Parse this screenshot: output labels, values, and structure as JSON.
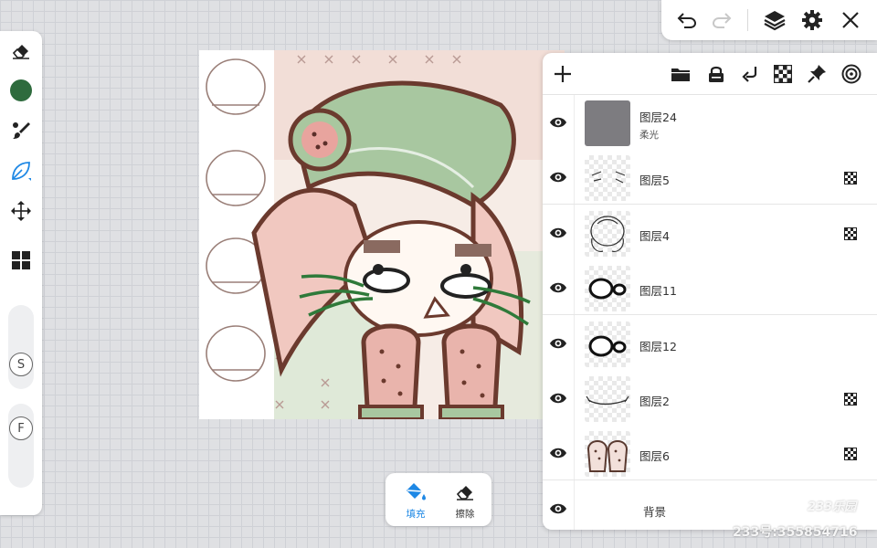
{
  "left_toolbar": {
    "tools": [
      {
        "name": "eraser",
        "icon": "eraser-icon",
        "active": false
      },
      {
        "name": "color",
        "icon": "color-swatch",
        "color": "#2e6b3d",
        "active": false
      },
      {
        "name": "brush",
        "icon": "brush-icon",
        "active": false
      },
      {
        "name": "smudge",
        "icon": "leaf-smudge-icon",
        "active": true
      },
      {
        "name": "move",
        "icon": "move-icon",
        "active": false
      },
      {
        "name": "grid",
        "icon": "grid-icon",
        "active": false
      }
    ],
    "size_slider_label": "S",
    "opacity_slider_label": "F"
  },
  "top_toolbar": {
    "icons": [
      "undo-icon",
      "redo-icon",
      "layers-icon",
      "gear-icon",
      "close-icon"
    ],
    "redo_disabled": true
  },
  "layers_panel": {
    "header_icons": [
      "add-icon",
      "folder-icon",
      "lock-icon",
      "merge-down-icon",
      "checker-icon",
      "pin-icon",
      "target-icon"
    ],
    "layers": [
      {
        "name": "图层24",
        "blend": "柔光",
        "alpha_lock": false,
        "thumb": "gray"
      },
      {
        "name": "图层5",
        "blend": "",
        "alpha_lock": true,
        "thumb": "eyes"
      },
      {
        "name": "图层4",
        "blend": "",
        "alpha_lock": true,
        "thumb": "sketch"
      },
      {
        "name": "图层11",
        "blend": "",
        "alpha_lock": false,
        "thumb": "blob"
      },
      {
        "name": "图层12",
        "blend": "",
        "alpha_lock": false,
        "thumb": "blob"
      },
      {
        "name": "图层2",
        "blend": "",
        "alpha_lock": true,
        "thumb": "mouth"
      },
      {
        "name": "图层6",
        "blend": "",
        "alpha_lock": true,
        "thumb": "strawberries"
      },
      {
        "name": "背景",
        "blend": "",
        "alpha_lock": false,
        "thumb": "none"
      }
    ]
  },
  "bottom_tools": {
    "fill_label": "填充",
    "erase_label": "擦除",
    "active": "fill"
  },
  "watermark": {
    "text": "233号:355854716",
    "logo": "233乐园"
  },
  "colors": {
    "accent": "#1e88e5",
    "current_color": "#2e6b3d",
    "panel_bg": "#ffffff"
  }
}
